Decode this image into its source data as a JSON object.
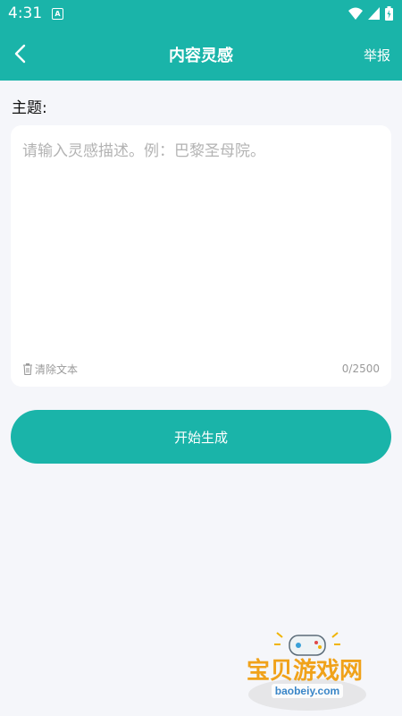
{
  "status": {
    "time": "4:31",
    "a_icon": "A"
  },
  "appbar": {
    "title": "内容灵感",
    "report": "举报"
  },
  "topic": {
    "label": "主题:"
  },
  "input": {
    "placeholder": "请输入灵感描述。例：巴黎圣母院。",
    "value": ""
  },
  "actions": {
    "clear": "清除文本",
    "counter": "0/2500",
    "generate": "开始生成"
  },
  "colors": {
    "primary": "#1ab4a9",
    "background": "#f5f6fa"
  },
  "watermark": {
    "name": "宝贝游戏网",
    "domain": "baobeiy.com"
  }
}
